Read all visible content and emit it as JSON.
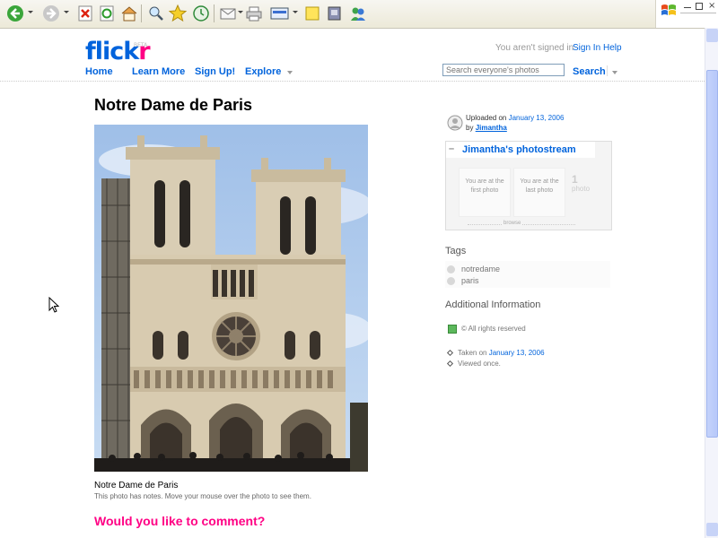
{
  "browser": {
    "toolbar_icons": [
      "back-icon",
      "forward-icon",
      "stop-icon",
      "refresh-icon",
      "home-icon",
      "search-icon",
      "favorites-icon",
      "history-icon",
      "mail-icon",
      "print-icon",
      "edit-icon",
      "note-icon",
      "messenger-icon",
      "contacts-icon"
    ],
    "window_controls": [
      "minimize-icon",
      "restore-icon",
      "close-icon"
    ]
  },
  "header": {
    "logo_part1": "flick",
    "logo_part2": "r",
    "logo_badge": "BETA",
    "not_signed_in": "You aren't signed in",
    "sign_in": "Sign In",
    "help": "Help",
    "nav": [
      "Home",
      "Learn More",
      "Sign Up!",
      "Explore"
    ],
    "search_placeholder": "Search everyone's photos",
    "search_button": "Search"
  },
  "photo": {
    "title": "Notre Dame de Paris",
    "caption": "Notre Dame de Paris",
    "note": "This photo has notes. Move your mouse over the photo to see them.",
    "comment_heading": "Would you like to comment?"
  },
  "sidebar": {
    "uploaded_prefix": "Uploaded on",
    "uploaded_date": "January 13, 2006",
    "by_prefix": "by",
    "owner": "Jimantha",
    "stream_title": "Jimantha's photostream",
    "stream_toggle": "–",
    "slot_first": "You are at the first photo",
    "slot_last": "You are at the last photo",
    "photo_count": "1",
    "photo_label": "photo",
    "browse": "browse",
    "tags_heading": "Tags",
    "tags": [
      "notredame",
      "paris"
    ],
    "additional_heading": "Additional Information",
    "rights": "© All rights reserved",
    "taken_prefix": "Taken on",
    "taken_date": "January 13, 2006",
    "viewed": "Viewed once."
  },
  "colors": {
    "flickr_blue": "#0063dc",
    "flickr_pink": "#ff0084"
  }
}
